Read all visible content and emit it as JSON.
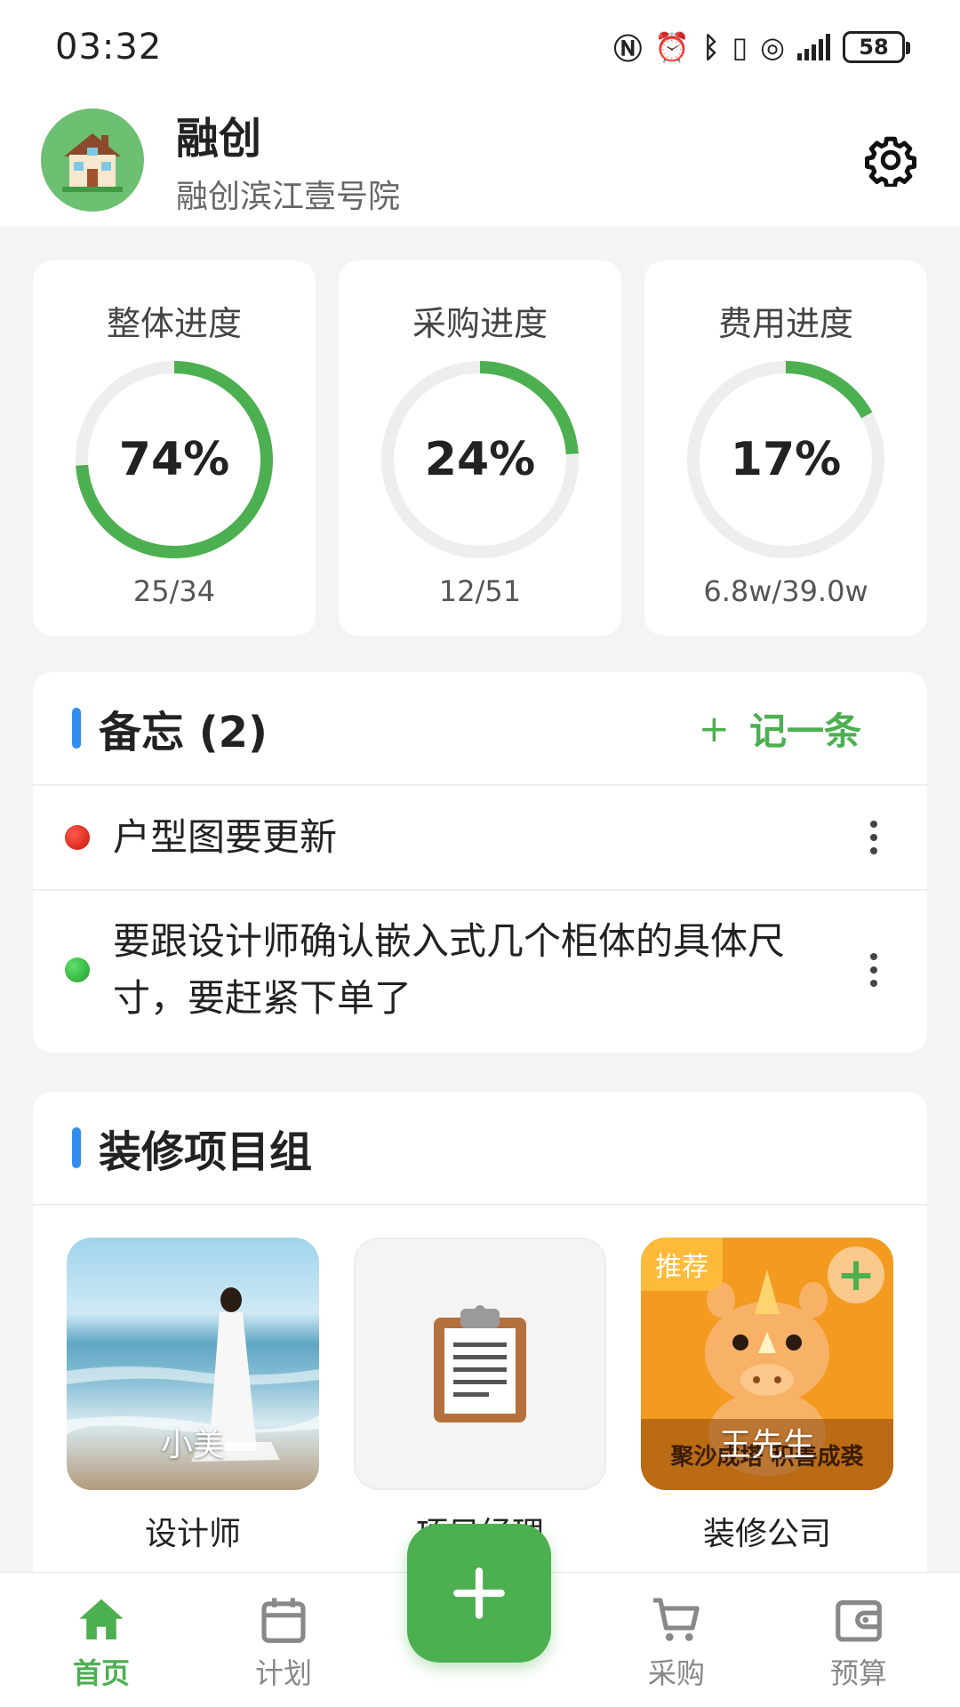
{
  "status_bar": {
    "time": "03:32",
    "battery": "58",
    "icons": [
      "nfc-icon",
      "alarm-icon",
      "bluetooth-icon",
      "vibrate-icon",
      "hotspot-icon",
      "signal-icon"
    ]
  },
  "header": {
    "title": "融创",
    "subtitle": "融创滨江壹号院"
  },
  "progress": [
    {
      "title": "整体进度",
      "percent_text": "74%",
      "value": 0.74,
      "detail": "25/34"
    },
    {
      "title": "采购进度",
      "percent_text": "24%",
      "value": 0.24,
      "detail": "12/51"
    },
    {
      "title": "费用进度",
      "percent_text": "17%",
      "value": 0.17,
      "detail": "6.8w/39.0w"
    }
  ],
  "memo": {
    "title": "备忘 (2)",
    "add_plus": "+",
    "add_label": "记一条",
    "items": [
      {
        "text": "户型图要更新",
        "color": "red"
      },
      {
        "text": "要跟设计师确认嵌入式几个柜体的具体尺寸，要赶紧下单了",
        "color": "green"
      }
    ]
  },
  "team": {
    "title": "装修项目组",
    "members": [
      {
        "role": "设计师",
        "name": "小美"
      },
      {
        "role": "项目经理",
        "name": ""
      },
      {
        "role": "装修公司",
        "name": "王先生",
        "tag": "推荐",
        "plus": "+",
        "slogan": "聚沙成塔 积善成裘"
      }
    ]
  },
  "nav": {
    "items": [
      {
        "label": "首页",
        "icon": "home-icon",
        "active": true
      },
      {
        "label": "计划",
        "icon": "calendar-icon",
        "active": false
      },
      {
        "label": "采购",
        "icon": "cart-icon",
        "active": false
      },
      {
        "label": "预算",
        "icon": "wallet-icon",
        "active": false
      }
    ],
    "fab_icon": "plus-icon"
  },
  "colors": {
    "accent": "#4caf50",
    "ring_track": "#eeeeee",
    "section_bar": "#2f8ef0"
  }
}
